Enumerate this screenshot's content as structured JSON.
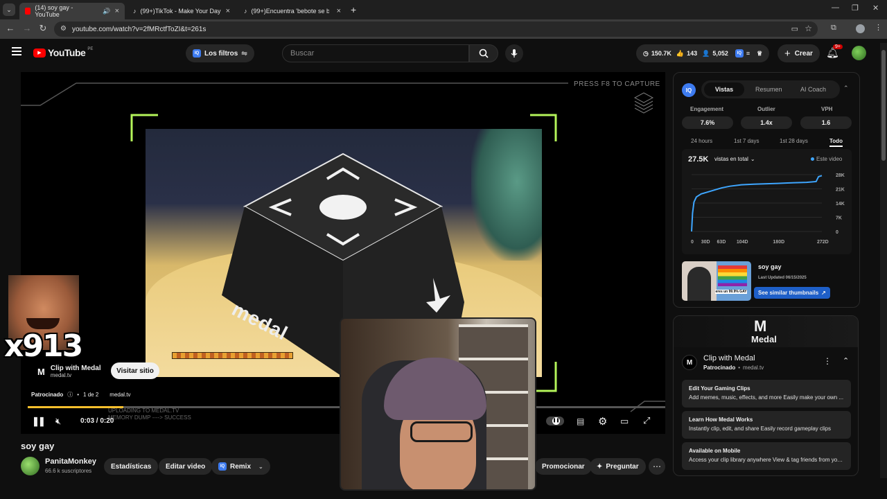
{
  "tabs": [
    {
      "title": "(14) soy gay - YouTube",
      "active": true
    },
    {
      "title": "(99+)TikTok - Make Your Day",
      "active": false
    },
    {
      "title": "(99+)Encuentra 'bebote se besa",
      "active": false
    }
  ],
  "address": {
    "url": "youtube.com/watch?v=2fMRctfToZI&t=261s"
  },
  "header": {
    "logo_text": "YouTube",
    "region": "PE",
    "filters_label": "Los filtros",
    "search_placeholder": "Buscar",
    "stats": {
      "views": "150.7K",
      "likes": "143",
      "subs": "5,052"
    },
    "create_label": "Crear",
    "notif_badge": "9+"
  },
  "player": {
    "capture_hint": "PRESS F8 TO CAPTURE",
    "medal_logo_text": "medal",
    "overlay_text_1": "UPLOADING TO MEDAL.TV",
    "overlay_text_2": "MEMORY DUMP ----> SUCCESS",
    "meme_counter": "x913",
    "ad": {
      "title": "Clip with Medal",
      "domain": "medal.tv",
      "cta": "Visitar sitio",
      "sponsored": "Patrocinado",
      "count": "1 de 2",
      "link": "medal.tv"
    },
    "time": "0:03 / 0:20",
    "progress": 0.15
  },
  "video": {
    "title": "soy gay",
    "channel": "PanitaMonkey",
    "subs": "66.6 k suscriptores",
    "buttons": {
      "stats": "Estadísticas",
      "edit": "Editar video",
      "remix": "Remix",
      "promote": "Promocionar",
      "ask": "Preguntar"
    }
  },
  "iq_panel": {
    "tabs": [
      "Vistas",
      "Resumen",
      "AI Coach"
    ],
    "metrics": [
      {
        "label": "Engagement",
        "value": "7.6%"
      },
      {
        "label": "Outlier",
        "value": "1.4x"
      },
      {
        "label": "VPH",
        "value": "1.6"
      }
    ],
    "ranges": [
      "24 hours",
      "1st 7 days",
      "1st 28 days",
      "Todo"
    ],
    "total": "27.5K",
    "total_dropdown": "vistas en total",
    "legend": "Este video",
    "thumb_title": "soy gay",
    "thumb_updated": "Last Updated 06/15/2025",
    "thumb_caption": "eres un 99.9% GAY",
    "similar_btn": "See similar thumbnails"
  },
  "chart_data": {
    "type": "line",
    "x": [
      0,
      2,
      5,
      10,
      20,
      30,
      50,
      63,
      80,
      104,
      130,
      180,
      200,
      240,
      260,
      265,
      272
    ],
    "values": [
      0,
      9000,
      14500,
      17000,
      18500,
      19200,
      20600,
      21500,
      22300,
      23000,
      23300,
      23700,
      23900,
      24200,
      24600,
      27000,
      27500
    ],
    "x_ticks": [
      "0",
      "30D",
      "63D",
      "104D",
      "180D",
      "272D"
    ],
    "y_ticks": [
      "28K",
      "21K",
      "14K",
      "7K",
      "0"
    ],
    "xlim": [
      0,
      272
    ],
    "ylim": [
      0,
      28000
    ],
    "grid": true,
    "color": "#3ea6ff"
  },
  "ad_panel": {
    "brand": "Medal",
    "title": "Clip with Medal",
    "sponsored": "Patrocinado",
    "domain": "medal.tv",
    "cards": [
      {
        "title": "Edit Your Gaming Clips",
        "desc": "Add memes, music, effects, and more Easily make your own ..."
      },
      {
        "title": "Learn How Medal Works",
        "desc": "Instantly clip, edit, and share Easily record gameplay clips"
      },
      {
        "title": "Available on Mobile",
        "desc": "Access your clip library anywhere View & tag friends from you..."
      }
    ]
  },
  "colors": {
    "accent": "#3ea6ff",
    "brand_red": "#ff0000",
    "medal_green": "#b4f55a",
    "iq_blue": "#3d7bf0"
  }
}
